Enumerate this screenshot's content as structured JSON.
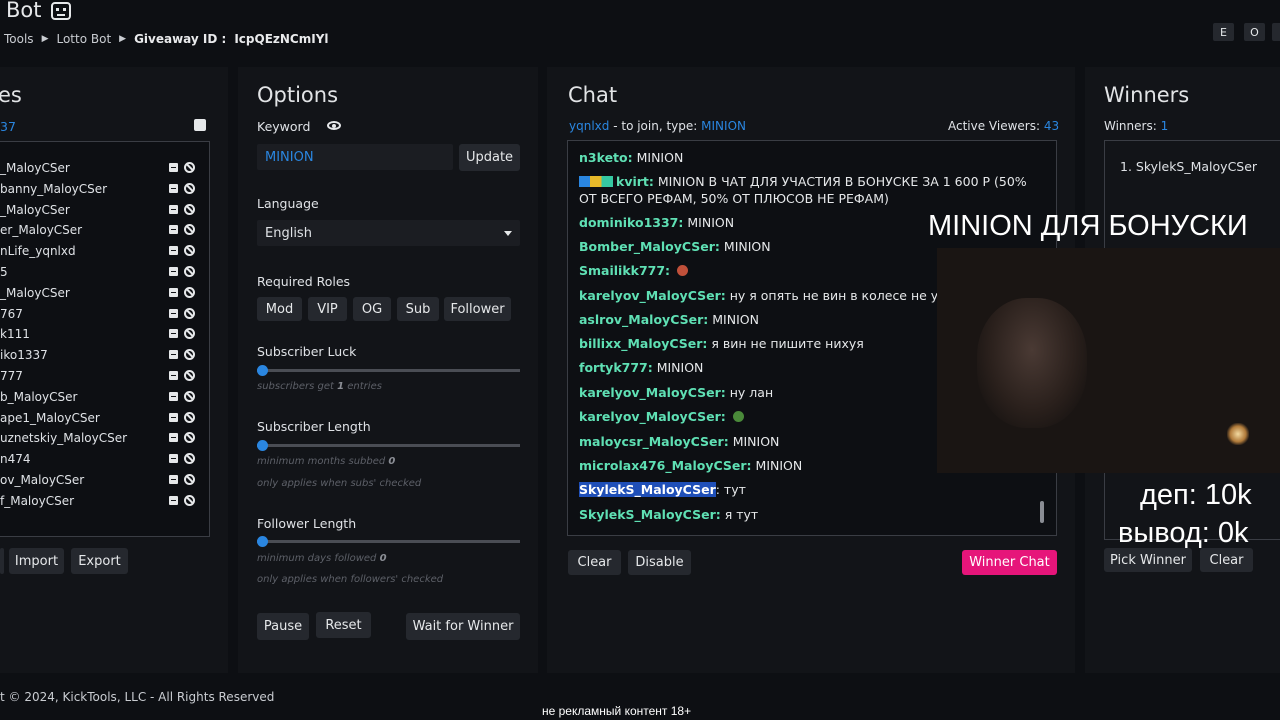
{
  "app": {
    "title": "Bot",
    "breadcrumb": [
      "Tools",
      "Lotto Bot",
      "Giveaway ID :",
      "IcpQEzNCmIYl"
    ],
    "top_buttons": [
      "E",
      "O"
    ]
  },
  "entries": {
    "title": "es",
    "count": "37",
    "items": [
      "_MaloyCSer",
      "banny_MaloyCSer",
      "_MaloyCSer",
      "er_MaloyCSer",
      "nLife_yqnlxd",
      "5",
      "_MaloyCSer",
      "767",
      "k111",
      "iko1337",
      "777",
      "b_MaloyCSer",
      "ape1_MaloyCSer",
      "uznetskiy_MaloyCSer",
      "n474",
      "ov_MaloyCSer",
      "f_MaloyCSer"
    ],
    "buttons": {
      "import": "Import",
      "export": "Export"
    }
  },
  "options": {
    "title": "Options",
    "keyword_label": "Keyword",
    "keyword_value": "MINION",
    "update": "Update",
    "language_label": "Language",
    "language_value": "English",
    "roles_label": "Required Roles",
    "roles": [
      "Mod",
      "VIP",
      "OG",
      "Sub",
      "Follower"
    ],
    "sub_luck": {
      "label": "Subscriber Luck",
      "hint_pre": "subscribers get",
      "hint_val": "1",
      "hint_post": "entries",
      "value": 0
    },
    "sub_length": {
      "label": "Subscriber Length",
      "hint_pre": "minimum months subbed",
      "hint_val": "0",
      "hint2": "only applies when subs' checked",
      "value": 0
    },
    "follow_length": {
      "label": "Follower Length",
      "hint_pre": "minimum days followed",
      "hint_val": "0",
      "hint2": "only applies when followers' checked",
      "value": 0
    },
    "pause": "Pause",
    "reset": "Reset",
    "wait": "Wait for Winner"
  },
  "chat": {
    "title": "Chat",
    "channel": "yqnlxd",
    "join_text": "- to join, type:",
    "keyword": "MINION",
    "viewers_label": "Active Viewers:",
    "viewers": "43",
    "messages": [
      {
        "user": "n3keto:",
        "text": "MINION"
      },
      {
        "user": "kvirt:",
        "text": "MINION В ЧАТ ДЛЯ УЧАСТИЯ В БОНУСКЕ ЗА 1 600 Р (50% ОТ ВСЕГО РЕФАМ, 50% ОТ ПЛЮСОВ НЕ РЕФАМ)"
      },
      {
        "user": "dominiko1337:",
        "text": "MINION"
      },
      {
        "user": "Bomber_MaloyCSer:",
        "text": "MINION"
      },
      {
        "user": "Smailikk777:",
        "text": ""
      },
      {
        "user": "karelyov_MaloyCSer:",
        "text": "ну я опять не вин в колесе не удивле"
      },
      {
        "user": "aslrov_MaloyCSer:",
        "text": "MINION"
      },
      {
        "user": "billixx_MaloyCSer:",
        "text": "я вин не пишите нихуя"
      },
      {
        "user": "fortyk777:",
        "text": "MINION"
      },
      {
        "user": "karelyov_MaloyCSer:",
        "text": "ну лан"
      },
      {
        "user": "karelyov_MaloyCSer:",
        "text": ""
      },
      {
        "user": "maloycsr_MaloyCSer:",
        "text": "MINION"
      },
      {
        "user": "microlax476_MaloyCSer:",
        "text": "MINION"
      },
      {
        "user": "SkylekS_MaloyCSer",
        "text": ": тут"
      },
      {
        "user": "SkylekS_MaloyCSer:",
        "text": "я тут"
      }
    ],
    "clear": "Clear",
    "disable": "Disable",
    "winner_chat": "Winner Chat"
  },
  "winners": {
    "title": "Winners",
    "label": "Winners:",
    "count": "1",
    "list": [
      "1.  SkylekS_MaloyCSer"
    ],
    "pick": "Pick Winner",
    "clear": "Clear"
  },
  "stream": {
    "headline": "MINION ДЛЯ БОНУСКИ",
    "dep": "деп: 10k",
    "withdraw": "вывод: 0k",
    "subtitle": "не рекламный контент 18+"
  },
  "footer": "t © 2024, KickTools, LLC - All Rights Reserved",
  "colors": {
    "accent": "#2a86e0",
    "username": "#5fe0b4",
    "pink": "#e6157a"
  }
}
